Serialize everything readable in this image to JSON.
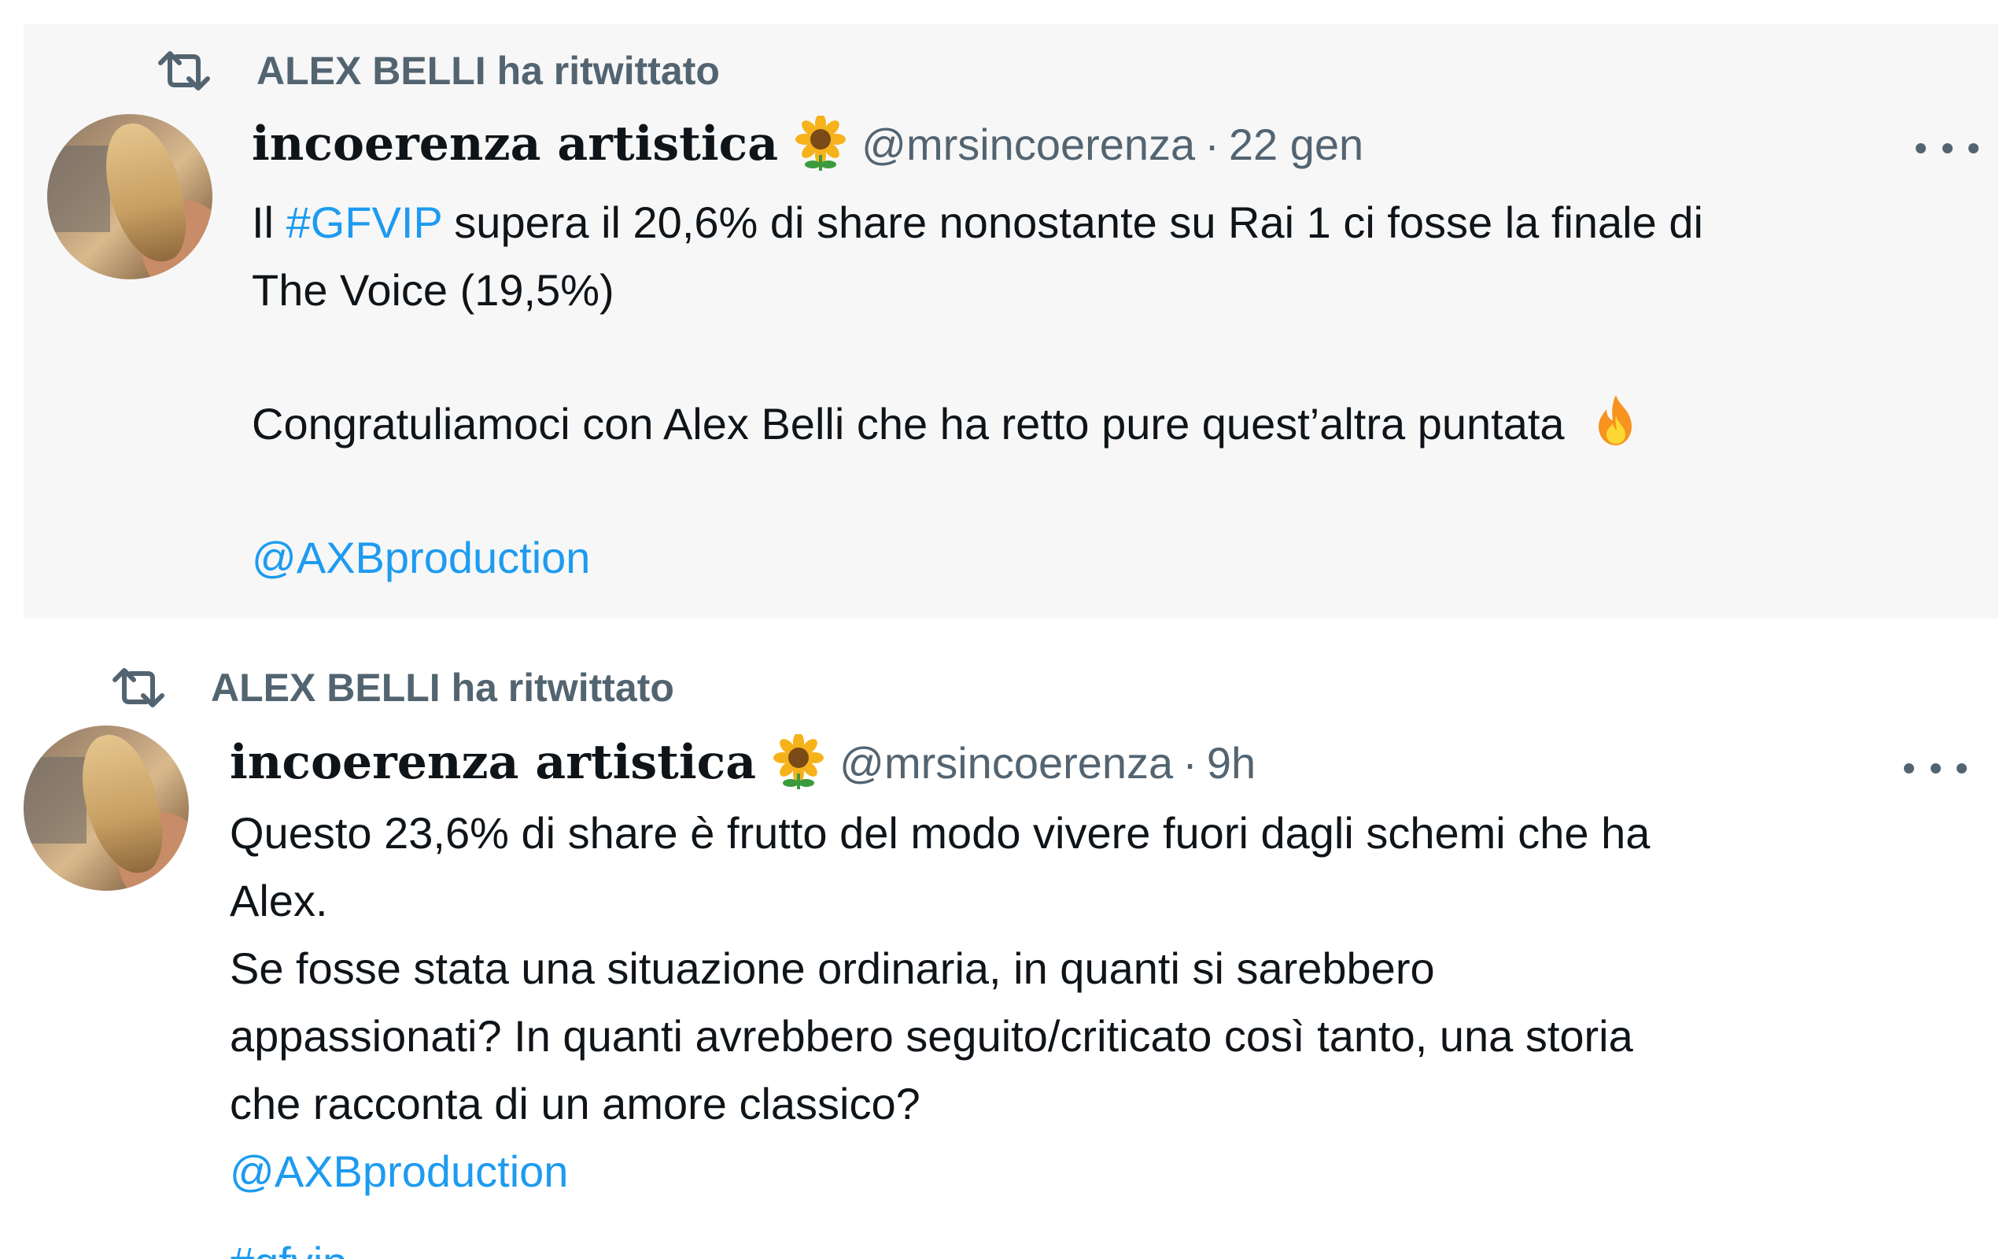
{
  "colors": {
    "text": "#0f1419",
    "secondary": "#536471",
    "link": "#1d9bf0",
    "highlight_bg": "#f7f7f7"
  },
  "tweets": [
    {
      "retweeted_by": "ALEX BELLI ha ritwittato",
      "display_name": "incoerenza artistica",
      "handle": "@mrsincoerenza",
      "dot": "·",
      "time": "22 gen",
      "line1_prefix": "Il",
      "hashtag": "#GFVIP",
      "line1_suffix": "supera il 20,6% di share nonostante su Rai 1 ci fosse la finale di",
      "line2": "The Voice (19,5%)",
      "line3": "Congratuliamoci con Alex Belli che ha retto pure quest’altra puntata",
      "mention": "@AXBproduction",
      "emoji_name": "fire-icon"
    },
    {
      "retweeted_by": "ALEX BELLI ha ritwittato",
      "display_name": "incoerenza artistica",
      "handle": "@mrsincoerenza",
      "dot": "·",
      "time": "9h",
      "lines": [
        "Questo 23,6% di share è frutto del modo vivere fuori dagli schemi che ha",
        "Alex.",
        "Se fosse stata una situazione ordinaria, in quanti si sarebbero",
        "appassionati? In quanti avrebbero seguito/criticato così tanto, una storia",
        "che racconta di un amore classico?"
      ],
      "mention": "@AXBproduction",
      "hashtag": "#gfvip"
    }
  ]
}
